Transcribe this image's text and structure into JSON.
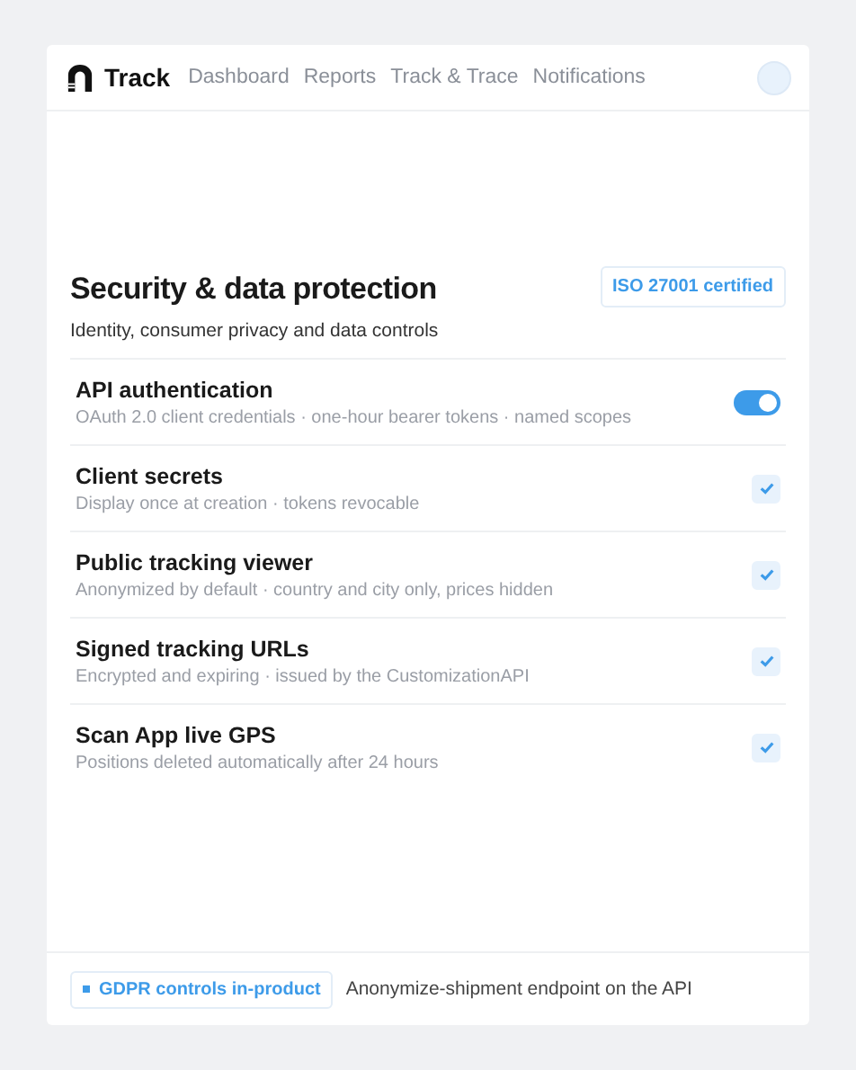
{
  "nav": {
    "brand": "Track",
    "links": [
      {
        "label": "Dashboard",
        "selected": false
      },
      {
        "label": "Reports",
        "selected": false
      },
      {
        "label": "Track & Trace",
        "selected": false
      },
      {
        "label": "Notifications",
        "selected": false
      }
    ]
  },
  "section": {
    "title": "Security & data protection",
    "subtitle": "Identity, consumer privacy and data controls",
    "badge": "ISO 27001 certified"
  },
  "settings": [
    {
      "kind": "toggle",
      "title": "API authentication",
      "description": "OAuth 2.0 client credentials · one-hour bearer tokens · named scopes",
      "on": true
    },
    {
      "kind": "checkbox",
      "title": "Client secrets",
      "description": "Display once at creation · tokens revocable",
      "checked": true
    },
    {
      "kind": "checkbox",
      "title": "Public tracking viewer",
      "description": "Anonymized by default · country and city only, prices hidden",
      "checked": true
    },
    {
      "kind": "checkbox",
      "title": "Signed tracking URLs",
      "description": "Encrypted and expiring · issued by the CustomizationAPI",
      "checked": true
    },
    {
      "kind": "checkbox",
      "title": "Scan App live GPS",
      "description": "Positions deleted automatically after 24 hours",
      "checked": true
    }
  ],
  "footer": {
    "tag": "GDPR controls in-product",
    "note": "Anonymize-shipment endpoint on the API"
  }
}
